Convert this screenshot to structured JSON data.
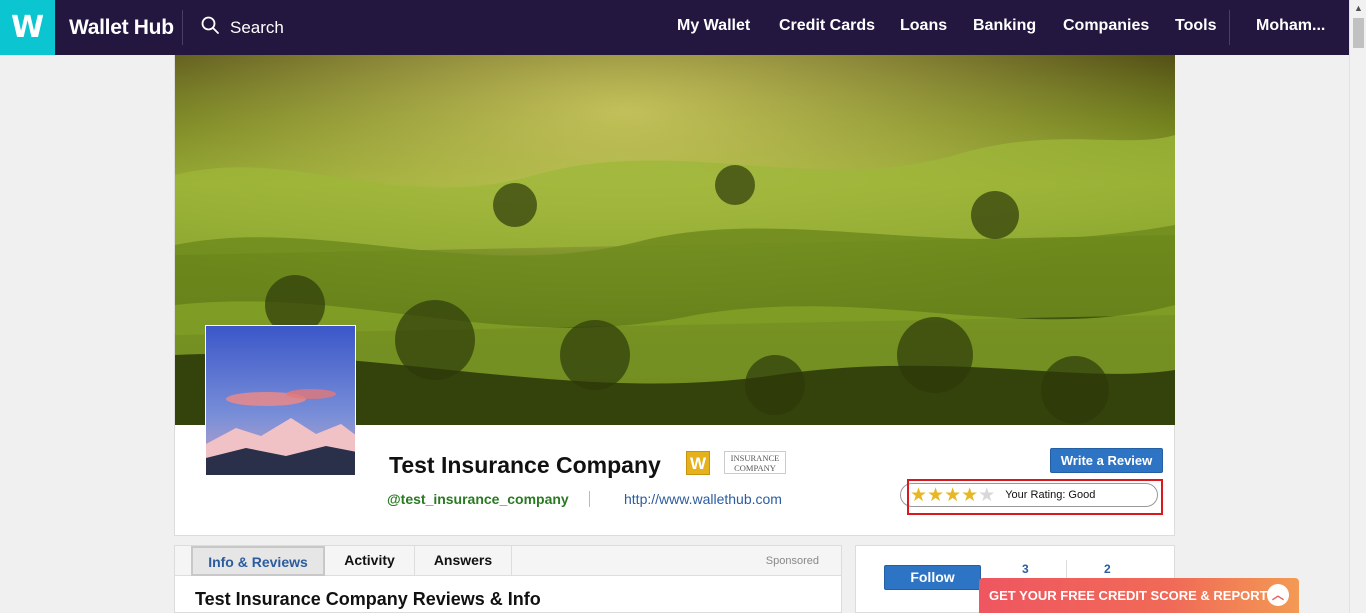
{
  "topnav": {
    "logo_letter": "W",
    "brand": "Wallet Hub",
    "search_label": "Search",
    "links": [
      "My Wallet",
      "Credit Cards",
      "Loans",
      "Banking",
      "Companies",
      "Tools"
    ],
    "user": "Moham..."
  },
  "profile": {
    "company_name": "Test Insurance Company",
    "w_badge": "W",
    "type_badge_line1": "INSURANCE",
    "type_badge_line2": "COMPANY",
    "handle": "@test_insurance_company",
    "website": "http://www.wallethub.com",
    "write_review_label": "Write a Review",
    "rating_stars": 4,
    "rating_max": 5,
    "rating_text": "Your Rating: Good"
  },
  "tabs": {
    "items": [
      "Info & Reviews",
      "Activity",
      "Answers"
    ],
    "active": "Info & Reviews",
    "sponsored": "Sponsored",
    "section_title": "Test Insurance Company Reviews & Info"
  },
  "side": {
    "follow_label": "Follow",
    "stat1": "3",
    "stat2": "2"
  },
  "promo": {
    "text": "GET YOUR FREE CREDIT SCORE & REPORT"
  },
  "colors": {
    "nav_bg": "#23163f",
    "logo_bg": "#0bc6d1",
    "primary_button": "#2e74c4",
    "handle_green": "#2a7a22",
    "highlight_red": "#d9191e",
    "promo": "#ef5660"
  }
}
